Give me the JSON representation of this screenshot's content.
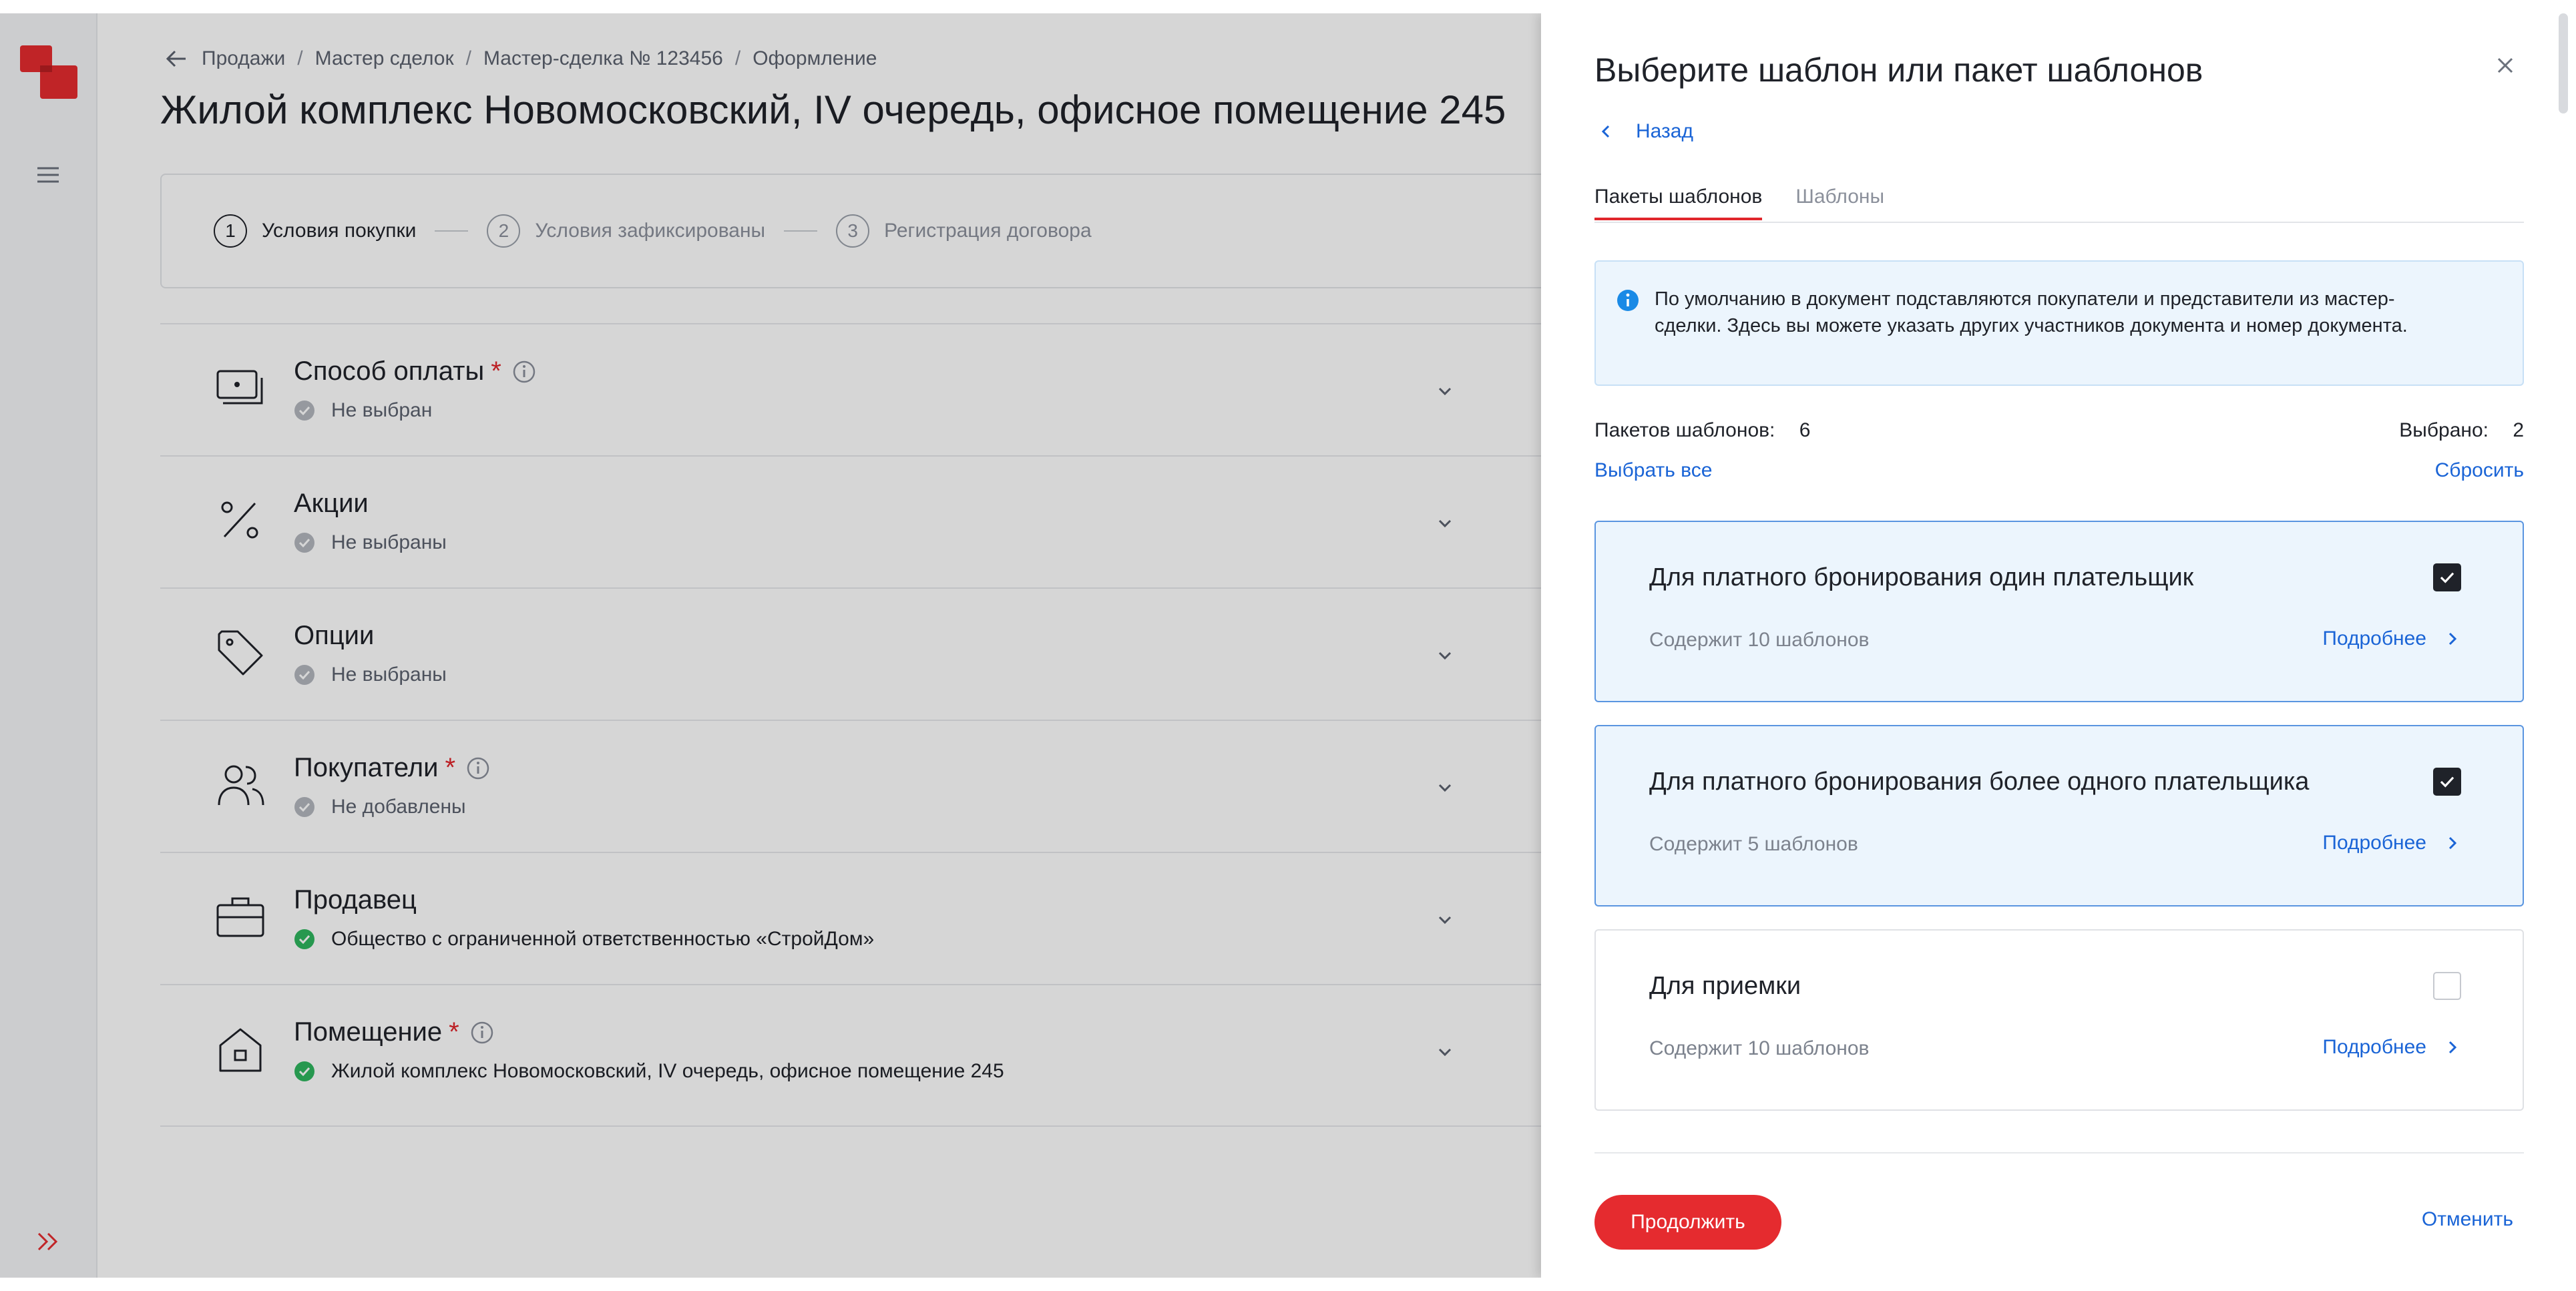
{
  "colors": {
    "brand_red": "#e52b2f",
    "link_blue": "#1a64d6",
    "selected_bg": "#ecf5fd",
    "success_green": "#2fb65f",
    "muted_gray": "#b3b7be"
  },
  "rail": {
    "logo_icon": "brand-logo-icon",
    "menu_icon": "hamburger-menu-icon",
    "expand_icon": "double-chevron-right-icon"
  },
  "breadcrumbs": [
    "Продажи",
    "Мастер сделок",
    "Мастер-сделка № 123456",
    "Оформление"
  ],
  "page_title": "Жилой комплекс Новомосковский, IV очередь, офисное помещение 245",
  "stepper": [
    {
      "num": "1",
      "label": "Условия покупки",
      "active": true
    },
    {
      "num": "2",
      "label": "Условия зафиксированы",
      "active": false
    },
    {
      "num": "3",
      "label": "Регистрация договора",
      "active": false
    }
  ],
  "sections": [
    {
      "title": "Способ оплаты",
      "required": "*",
      "icon": "payment-icon",
      "status": "Не выбран",
      "status_type": "empty"
    },
    {
      "title": "Акции",
      "required": "",
      "icon": "percent-icon",
      "status": "Не выбраны",
      "status_type": "empty"
    },
    {
      "title": "Опции",
      "required": "",
      "icon": "tag-icon",
      "status": "Не выбраны",
      "status_type": "empty"
    },
    {
      "title": "Покупатели",
      "required": "*",
      "icon": "users-icon",
      "status": "Не добавлены",
      "status_type": "empty"
    },
    {
      "title": "Продавец",
      "required": "",
      "icon": "briefcase-icon",
      "status": "Общество с ограниченной ответственностью «СтройДом»",
      "status_type": "ok"
    },
    {
      "title": "Помещение",
      "required": "*",
      "icon": "house-icon",
      "status": "Жилой комплекс Новомосковский, IV очередь, офисное помещение 245",
      "status_type": "ok"
    }
  ],
  "panel": {
    "title": "Выберите шаблон или пакет шаблонов",
    "back_label": "Назад",
    "tabs": [
      {
        "label": "Пакеты шаблонов",
        "active": true
      },
      {
        "label": "Шаблоны",
        "active": false
      }
    ],
    "notice": "По умолчанию в документ подставляются покупатели и представители из мастер-сделки. Здесь вы можете указать других участников документа и номер документа.",
    "packages_label": "Пакетов шаблонов:",
    "packages_count": "6",
    "selected_label": "Выбрано:",
    "selected_count": "2",
    "select_all": "Выбрать все",
    "reset": "Сбросить",
    "cards": [
      {
        "title": "Для платного бронирования один плательщик",
        "subtitle": "Содержит 10 шаблонов",
        "more": "Подробнее",
        "checked": true
      },
      {
        "title": "Для платного бронирования более одного плательщика",
        "subtitle": "Содержит 5 шаблонов",
        "more": "Подробнее",
        "checked": true
      },
      {
        "title": "Для приемки",
        "subtitle": "Содержит 10 шаблонов",
        "more": "Подробнее",
        "checked": false
      }
    ],
    "continue_label": "Продолжить",
    "cancel_label": "Отменить"
  }
}
